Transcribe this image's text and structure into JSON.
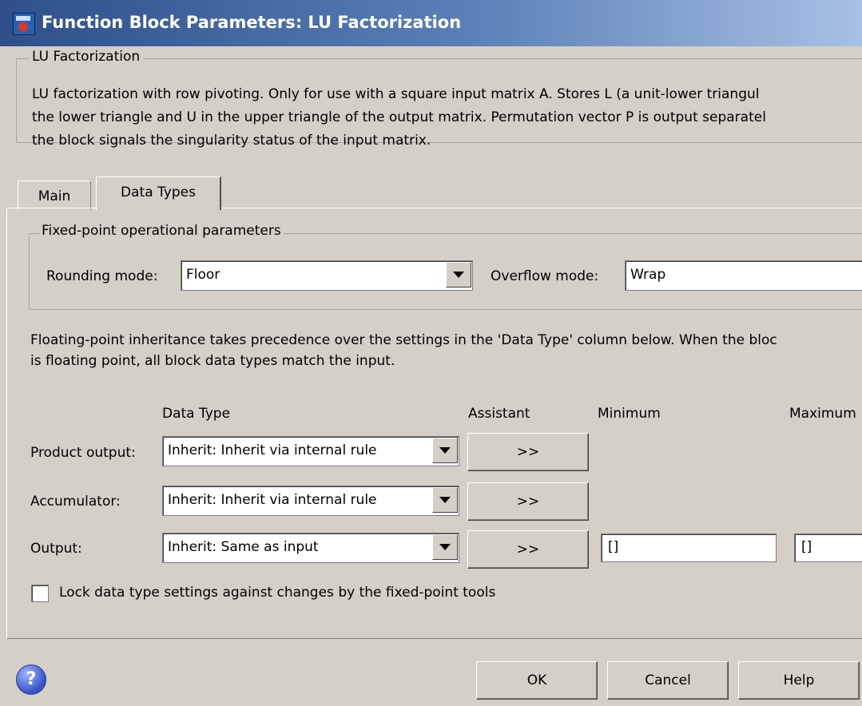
{
  "window": {
    "title": "Function Block Parameters: LU Factorization"
  },
  "description": {
    "legend": "LU Factorization",
    "lines": [
      "LU factorization with row pivoting.  Only for use with a square input matrix A.  Stores L (a unit-lower triangul",
      "the lower triangle and U in the upper triangle of the output matrix.  Permutation vector P is output separatel",
      "the block signals the singularity status of the input matrix."
    ]
  },
  "tabs": [
    {
      "label": "Main",
      "active": false
    },
    {
      "label": "Data Types",
      "active": true
    }
  ],
  "fixed_point": {
    "legend": "Fixed-point operational parameters",
    "rounding_label": "Rounding mode:",
    "rounding_value": "Floor",
    "overflow_label": "Overflow mode:",
    "overflow_value": "Wrap"
  },
  "floating_note": [
    "Floating-point inheritance takes precedence over the settings in the 'Data Type' column below. When the bloc",
    "is floating point, all block data types match the input."
  ],
  "table": {
    "headers": {
      "data_type": "Data Type",
      "assistant": "Assistant",
      "minimum": "Minimum",
      "maximum": "Maximum"
    },
    "rows": [
      {
        "label": "Product output:",
        "data_type": "Inherit: Inherit via internal rule",
        "assistant": ">>"
      },
      {
        "label": "Accumulator:",
        "data_type": "Inherit: Inherit via internal rule",
        "assistant": ">>"
      },
      {
        "label": "Output:",
        "data_type": "Inherit: Same as input",
        "assistant": ">>",
        "minimum": "[]",
        "maximum": "[]"
      }
    ]
  },
  "lock": {
    "label": "Lock data type settings against changes by the fixed-point tools",
    "checked": false
  },
  "footer": {
    "ok": "OK",
    "cancel": "Cancel",
    "help": "Help",
    "help_icon": "?"
  },
  "icons": {
    "app": "simulink-block-icon",
    "help": "help-question-icon",
    "dropdown": "chevron-down-icon"
  }
}
